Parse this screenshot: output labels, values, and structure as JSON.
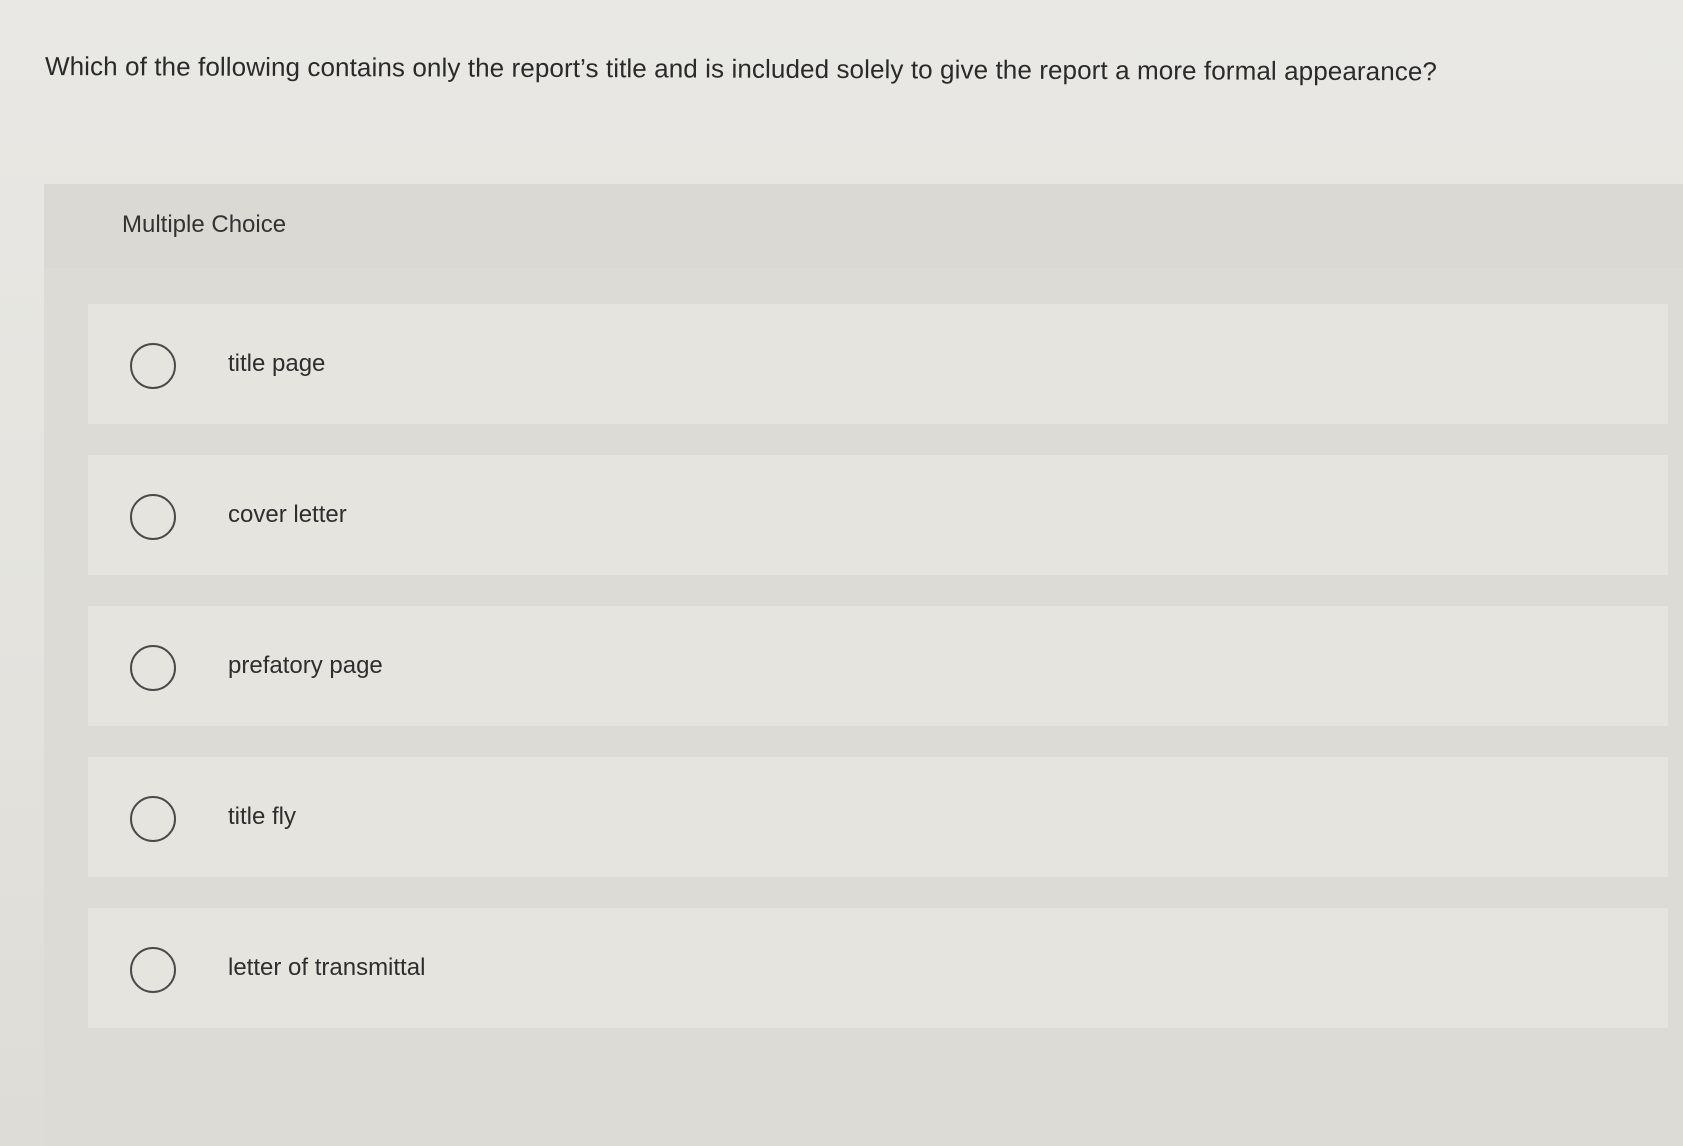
{
  "question": {
    "text": "Which of the following contains only the report’s title and is included solely to give the report a more formal appearance?"
  },
  "multiple_choice": {
    "label": "Multiple Choice",
    "options": [
      {
        "label": "title page"
      },
      {
        "label": "cover letter"
      },
      {
        "label": "prefatory page"
      },
      {
        "label": "title fly"
      },
      {
        "label": "letter of transmittal"
      }
    ]
  },
  "colors": {
    "background": "#e6e5e0",
    "panel": "#dcdbd6",
    "option_bg": "#e5e4df",
    "radio_border": "#4a4a4a",
    "text": "#2b2b2b"
  },
  "icons": {
    "radio": "radio-empty-circle"
  }
}
